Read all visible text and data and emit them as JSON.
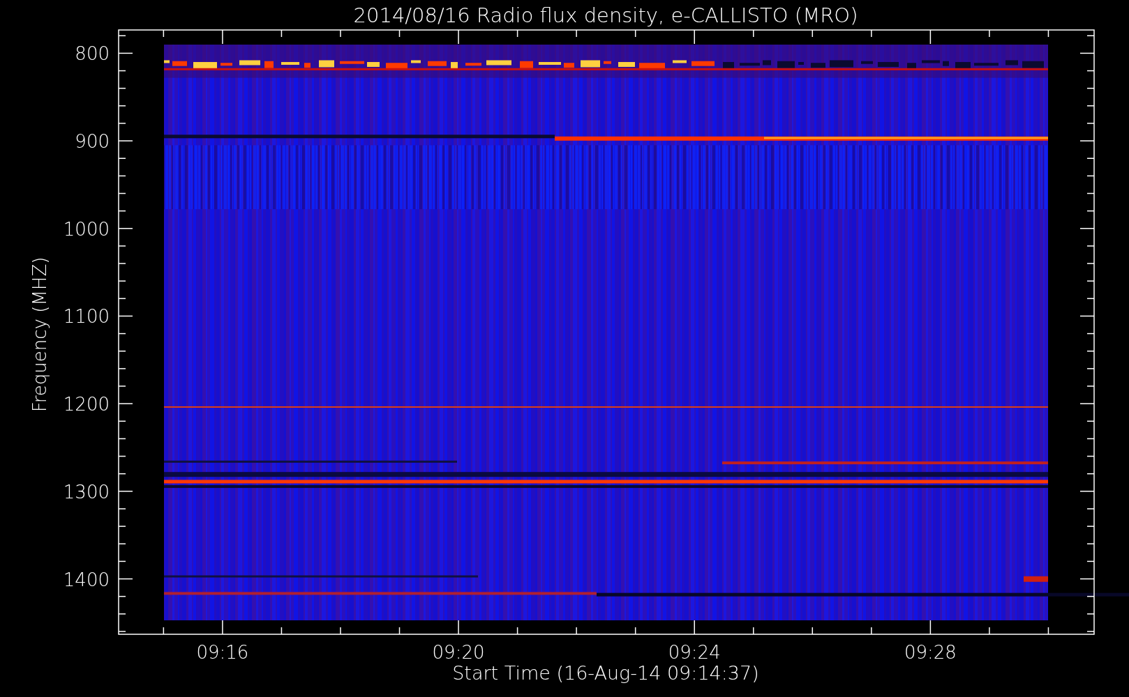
{
  "chart": {
    "title": "2014/08/16  Radio flux density, e-CALLISTO (MRO)",
    "ylabel": "Frequency (MHZ)",
    "xlabel": "Start Time (16-Aug-14 09:14:37)",
    "yticks": [
      "800",
      "900",
      "1000",
      "1100",
      "1200",
      "1300",
      "1400"
    ],
    "xticks": [
      "09:16",
      "09:20",
      "09:24",
      "09:28"
    ]
  }
}
